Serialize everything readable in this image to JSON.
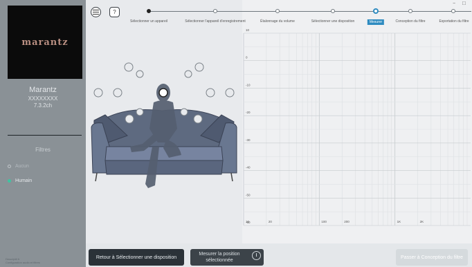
{
  "sidebar": {
    "logo": "marantz",
    "device_name": "Marantz",
    "device_serial": "XXXXXXXX",
    "device_channels": "7.3.2ch",
    "filters_title": "Filtres",
    "filter_options": [
      {
        "label": "Aucun",
        "selected": false
      },
      {
        "label": "Humain",
        "selected": true
      }
    ],
    "footer_line1": "Descriptif.fr",
    "footer_line2": "Configuration audio et filtres"
  },
  "header": {
    "menu_icon": "hamburger-icon",
    "help_label": "?",
    "window_min": "−",
    "window_max": "□",
    "steps": [
      {
        "label": "Sélectionner un appareil",
        "state": "done"
      },
      {
        "label": "Sélectionner l'appareil d'enregistrement",
        "state": "pending"
      },
      {
        "label": "Étalonnage du volume",
        "state": "pending"
      },
      {
        "label": "Sélectionner une disposition",
        "state": "pending"
      },
      {
        "label": "Mesurer",
        "state": "current"
      },
      {
        "label": "Conception du filtre",
        "state": "pending"
      },
      {
        "label": "Exportation du filtre",
        "state": "pending"
      }
    ]
  },
  "chart_data": {
    "type": "line",
    "y_ticks": [
      "10",
      "0",
      "-10",
      "-20",
      "-30",
      "-40",
      "-50",
      "-60"
    ],
    "ylim": [
      -60,
      10
    ],
    "x_ticks": [
      "10",
      "20",
      "100",
      "200",
      "1K",
      "2K",
      "10K"
    ],
    "x_scale": "log",
    "xlim": [
      10,
      10000
    ],
    "grid": true,
    "series": []
  },
  "footer": {
    "back_label": "Retour à Sélectionner une disposition",
    "measure_line1": "Mesurer la position",
    "measure_line2": "sélectionnée",
    "next_label": "Passer à Conception du filtre"
  },
  "colors": {
    "accent": "#2e8bc0",
    "selected_radio": "#3fc4a2",
    "sidebar": "#8a9196"
  }
}
